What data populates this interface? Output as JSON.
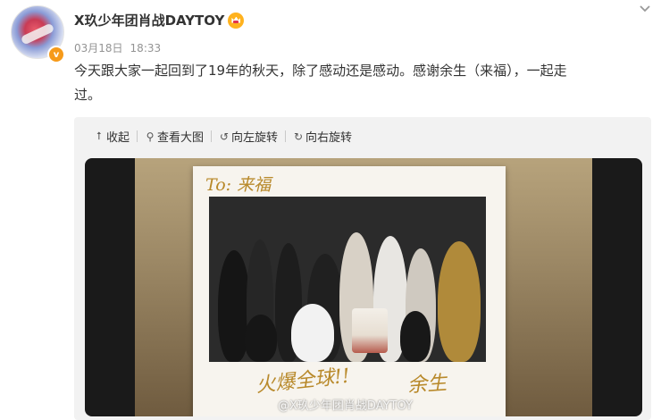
{
  "post": {
    "author": "X玖少年团肖战DAYTOY",
    "date": "03月18日",
    "time": "18:33",
    "text": "今天跟大家一起回到了19年的秋天，除了感动还是感动。感谢余生（来福），一起走\n过。"
  },
  "icons": {
    "verified": "verified-badge-icon",
    "crown": "crown-badge-icon",
    "collapse": "chevron-down-icon"
  },
  "toolbar": {
    "collapse_label": "收起",
    "view_large_label": "查看大图",
    "rotate_left_label": "向左旋转",
    "rotate_right_label": "向右旋转"
  },
  "photo": {
    "handwriting_top": "To: 来福",
    "handwriting_bottom": "火爆全球!!",
    "handwriting_sign": "余生",
    "watermark": "@X玖少年团肖战DAYTOY"
  },
  "colors": {
    "accent_orange": "#f69a1a",
    "link_gray": "#939393"
  }
}
